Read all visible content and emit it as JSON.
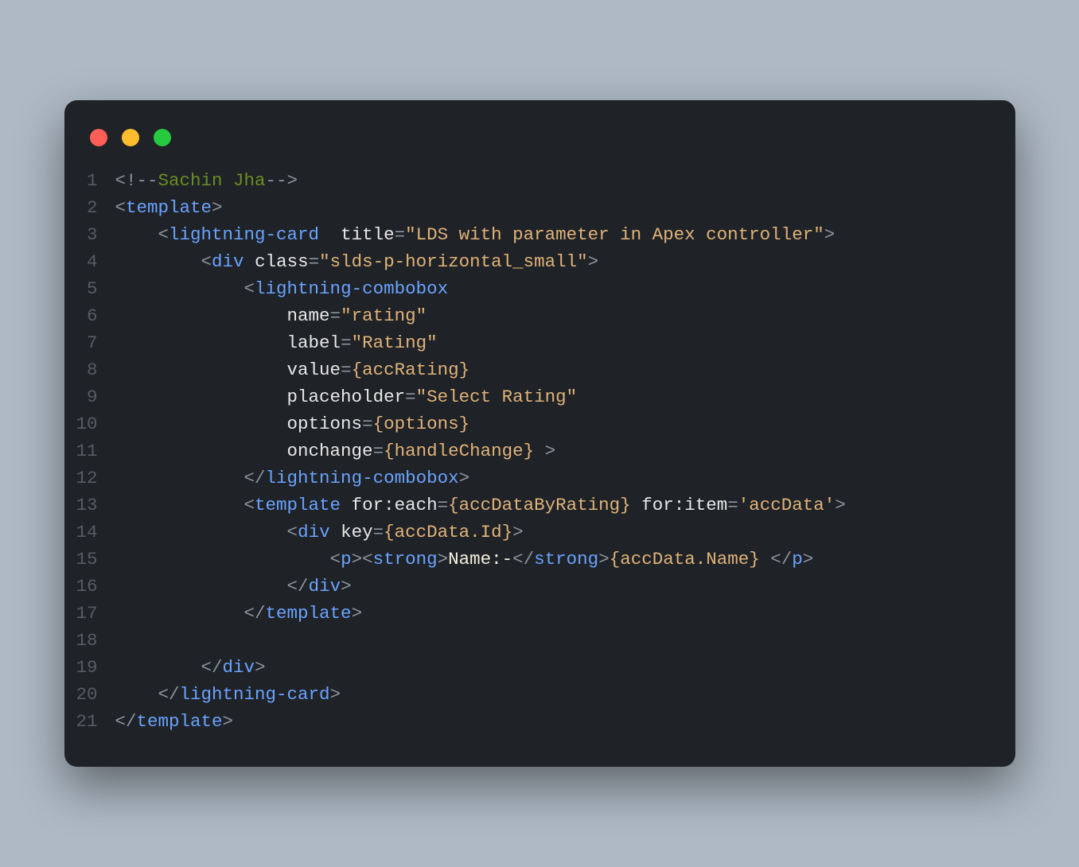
{
  "window": {
    "traffic_lights": [
      "red",
      "yellow",
      "green"
    ]
  },
  "code": {
    "line_numbers": [
      "1",
      "2",
      "3",
      "4",
      "5",
      "6",
      "7",
      "8",
      "9",
      "10",
      "11",
      "12",
      "13",
      "14",
      "15",
      "16",
      "17",
      "18",
      "19",
      "20",
      "21"
    ],
    "lines": [
      [
        {
          "c": "c-punc",
          "t": "<!--"
        },
        {
          "c": "c-comment",
          "t": "Sachin Jha"
        },
        {
          "c": "c-punc",
          "t": "-->"
        }
      ],
      [
        {
          "c": "c-punc",
          "t": "<"
        },
        {
          "c": "c-tag",
          "t": "template"
        },
        {
          "c": "c-punc",
          "t": ">"
        }
      ],
      [
        {
          "c": "",
          "t": "    "
        },
        {
          "c": "c-punc",
          "t": "<"
        },
        {
          "c": "c-tag",
          "t": "lightning-card"
        },
        {
          "c": "",
          "t": "  "
        },
        {
          "c": "c-attr",
          "t": "title"
        },
        {
          "c": "c-punc",
          "t": "="
        },
        {
          "c": "c-str",
          "t": "\"LDS with parameter in Apex controller\""
        },
        {
          "c": "c-punc",
          "t": ">"
        }
      ],
      [
        {
          "c": "",
          "t": "        "
        },
        {
          "c": "c-punc",
          "t": "<"
        },
        {
          "c": "c-tag",
          "t": "div"
        },
        {
          "c": "",
          "t": " "
        },
        {
          "c": "c-attr",
          "t": "class"
        },
        {
          "c": "c-punc",
          "t": "="
        },
        {
          "c": "c-str",
          "t": "\"slds-p-horizontal_small\""
        },
        {
          "c": "c-punc",
          "t": ">"
        }
      ],
      [
        {
          "c": "",
          "t": "            "
        },
        {
          "c": "c-punc",
          "t": "<"
        },
        {
          "c": "c-tag",
          "t": "lightning-combobox"
        }
      ],
      [
        {
          "c": "",
          "t": "                "
        },
        {
          "c": "c-attr",
          "t": "name"
        },
        {
          "c": "c-punc",
          "t": "="
        },
        {
          "c": "c-str",
          "t": "\"rating\""
        }
      ],
      [
        {
          "c": "",
          "t": "                "
        },
        {
          "c": "c-attr",
          "t": "label"
        },
        {
          "c": "c-punc",
          "t": "="
        },
        {
          "c": "c-str",
          "t": "\"Rating\""
        }
      ],
      [
        {
          "c": "",
          "t": "                "
        },
        {
          "c": "c-attr",
          "t": "value"
        },
        {
          "c": "c-punc",
          "t": "="
        },
        {
          "c": "c-handle",
          "t": "{accRating}"
        }
      ],
      [
        {
          "c": "",
          "t": "                "
        },
        {
          "c": "c-attr",
          "t": "placeholder"
        },
        {
          "c": "c-punc",
          "t": "="
        },
        {
          "c": "c-str",
          "t": "\"Select Rating\""
        }
      ],
      [
        {
          "c": "",
          "t": "                "
        },
        {
          "c": "c-attr",
          "t": "options"
        },
        {
          "c": "c-punc",
          "t": "="
        },
        {
          "c": "c-handle",
          "t": "{options}"
        }
      ],
      [
        {
          "c": "",
          "t": "                "
        },
        {
          "c": "c-attr",
          "t": "onchange"
        },
        {
          "c": "c-punc",
          "t": "="
        },
        {
          "c": "c-handle",
          "t": "{handleChange}"
        },
        {
          "c": "",
          "t": " "
        },
        {
          "c": "c-punc",
          "t": ">"
        }
      ],
      [
        {
          "c": "",
          "t": "            "
        },
        {
          "c": "c-punc",
          "t": "</"
        },
        {
          "c": "c-tag",
          "t": "lightning-combobox"
        },
        {
          "c": "c-punc",
          "t": ">"
        }
      ],
      [
        {
          "c": "",
          "t": "            "
        },
        {
          "c": "c-punc",
          "t": "<"
        },
        {
          "c": "c-tag",
          "t": "template"
        },
        {
          "c": "",
          "t": " "
        },
        {
          "c": "c-attr",
          "t": "for:each"
        },
        {
          "c": "c-punc",
          "t": "="
        },
        {
          "c": "c-handle",
          "t": "{accDataByRating}"
        },
        {
          "c": "",
          "t": " "
        },
        {
          "c": "c-attr",
          "t": "for:item"
        },
        {
          "c": "c-punc",
          "t": "="
        },
        {
          "c": "c-str",
          "t": "'accData'"
        },
        {
          "c": "c-punc",
          "t": ">"
        }
      ],
      [
        {
          "c": "",
          "t": "                "
        },
        {
          "c": "c-punc",
          "t": "<"
        },
        {
          "c": "c-tag",
          "t": "div"
        },
        {
          "c": "",
          "t": " "
        },
        {
          "c": "c-attr",
          "t": "key"
        },
        {
          "c": "c-punc",
          "t": "="
        },
        {
          "c": "c-handle",
          "t": "{accData.Id}"
        },
        {
          "c": "c-punc",
          "t": ">"
        }
      ],
      [
        {
          "c": "",
          "t": "                    "
        },
        {
          "c": "c-punc",
          "t": "<"
        },
        {
          "c": "c-tag",
          "t": "p"
        },
        {
          "c": "c-punc",
          "t": ">"
        },
        {
          "c": "c-punc",
          "t": "<"
        },
        {
          "c": "c-tag",
          "t": "strong"
        },
        {
          "c": "c-punc",
          "t": ">"
        },
        {
          "c": "c-text",
          "t": "Name:-"
        },
        {
          "c": "c-punc",
          "t": "</"
        },
        {
          "c": "c-tag",
          "t": "strong"
        },
        {
          "c": "c-punc",
          "t": ">"
        },
        {
          "c": "c-handle",
          "t": "{accData.Name}"
        },
        {
          "c": "",
          "t": " "
        },
        {
          "c": "c-punc",
          "t": "</"
        },
        {
          "c": "c-tag",
          "t": "p"
        },
        {
          "c": "c-punc",
          "t": ">"
        }
      ],
      [
        {
          "c": "",
          "t": "                "
        },
        {
          "c": "c-punc",
          "t": "</"
        },
        {
          "c": "c-tag",
          "t": "div"
        },
        {
          "c": "c-punc",
          "t": ">"
        }
      ],
      [
        {
          "c": "",
          "t": "            "
        },
        {
          "c": "c-punc",
          "t": "</"
        },
        {
          "c": "c-tag",
          "t": "template"
        },
        {
          "c": "c-punc",
          "t": ">"
        }
      ],
      [
        {
          "c": "",
          "t": ""
        }
      ],
      [
        {
          "c": "",
          "t": "        "
        },
        {
          "c": "c-punc",
          "t": "</"
        },
        {
          "c": "c-tag",
          "t": "div"
        },
        {
          "c": "c-punc",
          "t": ">"
        }
      ],
      [
        {
          "c": "",
          "t": "    "
        },
        {
          "c": "c-punc",
          "t": "</"
        },
        {
          "c": "c-tag",
          "t": "lightning-card"
        },
        {
          "c": "c-punc",
          "t": ">"
        }
      ],
      [
        {
          "c": "c-punc",
          "t": "</"
        },
        {
          "c": "c-tag",
          "t": "template"
        },
        {
          "c": "c-punc",
          "t": ">"
        }
      ]
    ]
  }
}
